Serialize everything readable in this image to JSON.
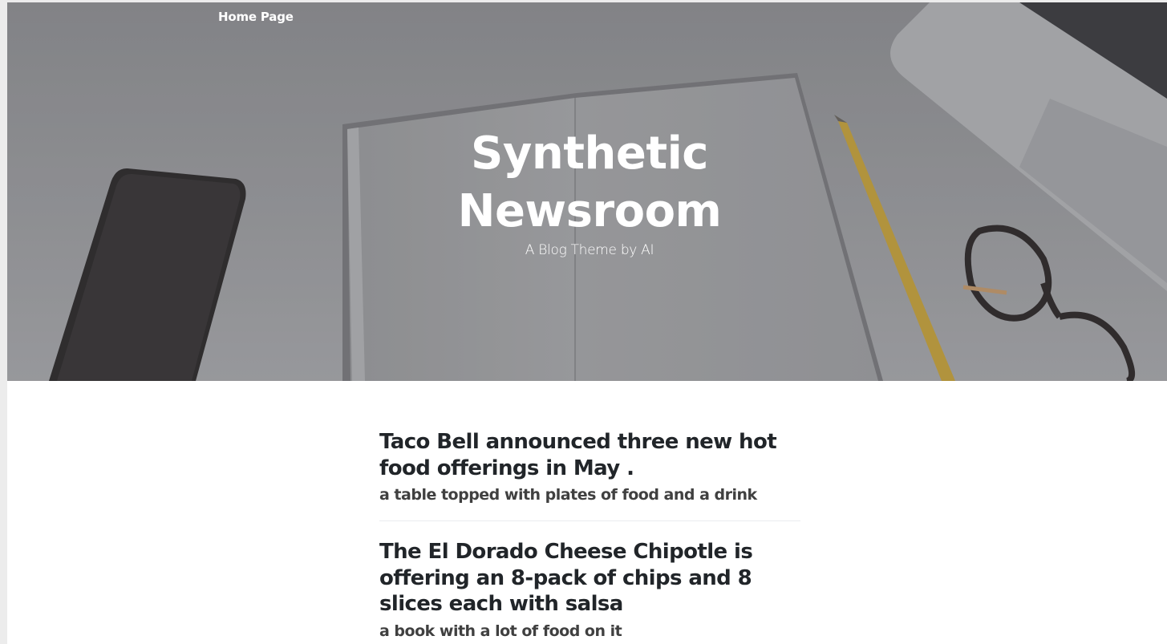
{
  "nav": {
    "home_label": "Home Page"
  },
  "hero": {
    "title": "Synthetic Newsroom",
    "subtitle": "A Blog Theme by AI"
  },
  "posts": [
    {
      "title": "Taco Bell announced three new hot food offerings in May .",
      "subtitle": "a table topped with plates of food and a drink"
    },
    {
      "title": "The El Dorado Cheese Chipotle is offering an 8-pack of chips and 8 slices each with salsa",
      "subtitle": "a book with a lot of food on it"
    }
  ],
  "colors": {
    "heading_text": "#212529",
    "body_text": "#404040",
    "hero_text": "#ffffff"
  }
}
